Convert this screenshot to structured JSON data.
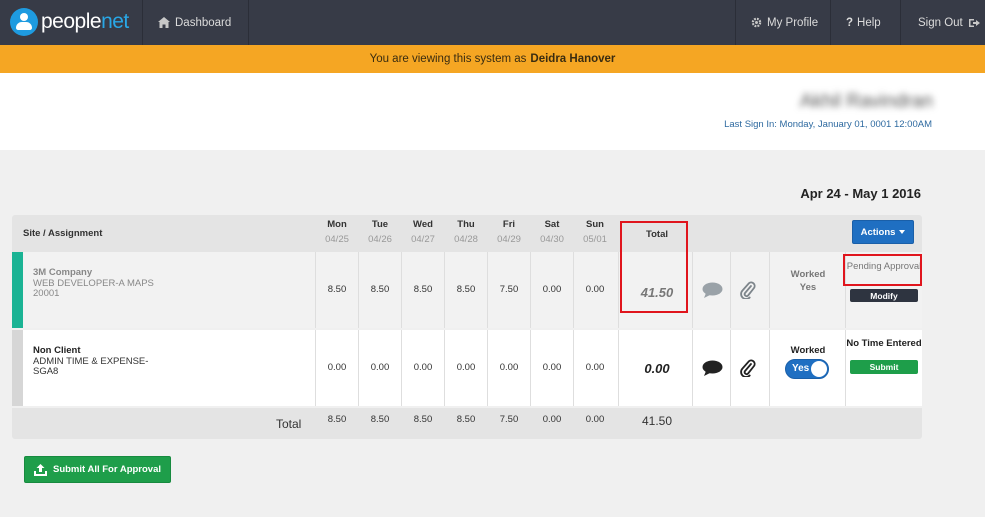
{
  "nav": {
    "logo_people": "people",
    "logo_net": "net",
    "dashboard": "Dashboard",
    "my_profile": "My Profile",
    "help": "Help",
    "sign_out": "Sign Out"
  },
  "banner": {
    "prefix": "You are viewing this system as",
    "user": "Deidra Hanover"
  },
  "header": {
    "user_name": "Akhil Ravindran",
    "last_sign_in": "Last Sign In: Monday, January 01, 0001 12:00AM"
  },
  "week": {
    "range": "Apr 24 - May 1 2016"
  },
  "table": {
    "site_header": "Site / Assignment",
    "total_header": "Total",
    "actions_label": "Actions",
    "days": [
      {
        "name": "Mon",
        "date": "04/25"
      },
      {
        "name": "Tue",
        "date": "04/26"
      },
      {
        "name": "Wed",
        "date": "04/27"
      },
      {
        "name": "Thu",
        "date": "04/28"
      },
      {
        "name": "Fri",
        "date": "04/29"
      },
      {
        "name": "Sat",
        "date": "04/30"
      },
      {
        "name": "Sun",
        "date": "05/01"
      }
    ],
    "rows": [
      {
        "company": "3M Company",
        "assignment": "WEB DEVELOPER-A MAPS",
        "code": "20001",
        "hours": [
          "8.50",
          "8.50",
          "8.50",
          "8.50",
          "7.50",
          "0.00",
          "0.00"
        ],
        "total": "41.50",
        "worked": "Worked",
        "worked_value": "Yes",
        "status": "Pending Approval",
        "button": "Modify"
      },
      {
        "company": "Non Client",
        "assignment": "ADMIN TIME & EXPENSE-",
        "code": "SGA8",
        "hours": [
          "0.00",
          "0.00",
          "0.00",
          "0.00",
          "0.00",
          "0.00",
          "0.00"
        ],
        "total": "0.00",
        "worked": "Worked",
        "toggle_label": "Yes",
        "status": "No Time Entered",
        "button": "Submit"
      }
    ],
    "footer": {
      "label": "Total",
      "hours": [
        "8.50",
        "8.50",
        "8.50",
        "8.50",
        "7.50",
        "0.00",
        "0.00"
      ],
      "grand_total": "41.50"
    }
  },
  "submit_all": "Submit All For Approval",
  "colors": {
    "nav_bg": "#373b47",
    "banner": "#f5a623",
    "accent_blue": "#1f6fc2",
    "green": "#1e9e4a",
    "teal_stripe": "#1ab394",
    "highlight_red": "#e0151d"
  }
}
